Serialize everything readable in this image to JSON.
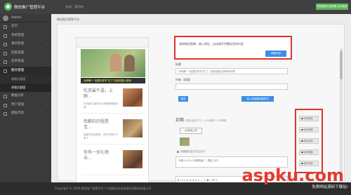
{
  "header": {
    "title": "微信推广管理平台",
    "subtitle": "（未读：暂时未）",
    "right_button": "您的服务已经到期 点击续费"
  },
  "sidebar": {
    "user": "Admin",
    "items": [
      {
        "label": "首页"
      },
      {
        "label": "系统管理"
      },
      {
        "label": "素材管理"
      },
      {
        "label": "回复管理"
      },
      {
        "label": "菜单管理"
      },
      {
        "label": "图文管理"
      },
      {
        "label": "数据分析"
      },
      {
        "label": "用户管理"
      },
      {
        "label": "模板市场"
      }
    ],
    "subitems": [
      {
        "label": "单图文管理"
      },
      {
        "label": "多图文管理"
      }
    ]
  },
  "main": {
    "breadcrumb": "微信图文管理平台"
  },
  "phone": {
    "hero_caption": "为林甫一“全国兄弟节”红了 自然田园小游戏",
    "news": [
      {
        "title": "吃货最牛逼，上图…",
        "desc": "吃货最牛逼的吃法来看看啊图来啊"
      },
      {
        "title": "南都的历程是宝…",
        "desc": "南都的历程是宝，好好的事件干事干"
      },
      {
        "title": "你有一份礼物未…",
        "desc": ""
      }
    ]
  },
  "editor": {
    "tip": "获取微信图章，输入网址，自动填写完整标签的内容",
    "tip_button": "获取内容",
    "title_label": "标题",
    "title_value": "为林甫一“全国兄弟节”红了，自然田园小游戏你可得",
    "author_label": "作者（选填）",
    "source_button": "预览",
    "insert_button": "插入其他素材图样式",
    "cover_label": "封面",
    "cover_hint": "小图片建议尺寸：200像素 * 200像素",
    "upload_button": "从本地上传",
    "checkbox_label": "封面图片显示在正文中",
    "summary_value": "今晚11/15 X 标题收藏 ？ 是能上来？",
    "toolbar": "B  I  U  S  ≡  ≡  ≡  ≡  ⇔  ⤢  ▢  ▣  ☐  ⚑  ✎"
  },
  "actions": [
    {
      "label": "手机预览"
    },
    {
      "label": "保存草稿"
    },
    {
      "label": "保存发布"
    },
    {
      "label": "保存模板"
    },
    {
      "label": "置为内容"
    }
  ],
  "footer": {
    "text": "Copyright © 2016 微信推广管理平台 | 宁波猫动文化网络科技股份有限公司"
  },
  "watermark": {
    "logo": "aspku.com",
    "sub": "免费网站源码下载站!"
  }
}
